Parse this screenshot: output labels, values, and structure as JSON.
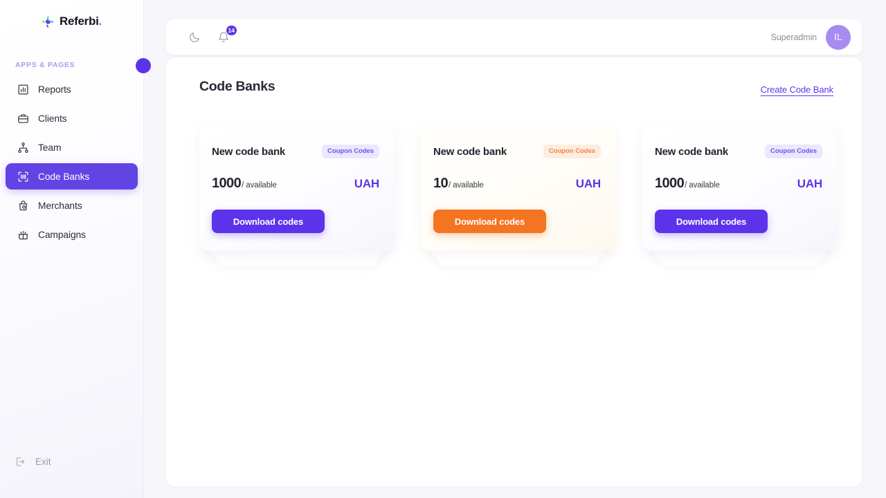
{
  "brand": {
    "name": "Referbi",
    "dot": ".",
    "logo_icon": "pinwheel-logo-icon"
  },
  "sidebar": {
    "section_label": "APPS & PAGES",
    "items": [
      {
        "label": "Reports",
        "icon": "bar-chart-icon",
        "active": false
      },
      {
        "label": "Clients",
        "icon": "briefcase-icon",
        "active": false
      },
      {
        "label": "Team",
        "icon": "org-chart-icon",
        "active": false
      },
      {
        "label": "Code Banks",
        "icon": "barcode-scan-icon",
        "active": true
      },
      {
        "label": "Merchants",
        "icon": "shopping-bag-icon",
        "active": false
      },
      {
        "label": "Campaigns",
        "icon": "gift-burst-icon",
        "active": false
      }
    ],
    "exit": {
      "label": "Exit",
      "icon": "logout-icon"
    },
    "collapse_knob": "collapse-sidebar-knob",
    "accent": "#5c33ea",
    "section_label_color": "#a99cf0"
  },
  "topbar": {
    "theme_toggle_icon": "moon-icon",
    "notifications_icon": "bell-icon",
    "notifications_count": "14",
    "user_name": "Superadmin",
    "avatar_initials": "IL",
    "avatar_color": "#a78bf0"
  },
  "main": {
    "title": "Code Banks",
    "create_link": "Create Code Bank",
    "cards": [
      {
        "title": "New code bank",
        "chip": "Coupon Codes",
        "count": "1000",
        "count_suffix": "/ available",
        "currency": "UAH",
        "button": "Download codes",
        "theme": "purple",
        "button_color": "#5c33ea",
        "chip_bg": "#ebe7fd",
        "chip_fg": "#6f51ef"
      },
      {
        "title": "New code bank",
        "chip": "Coupon Codes",
        "count": "10",
        "count_suffix": "/ available",
        "currency": "UAH",
        "button": "Download codes",
        "theme": "orange",
        "button_color": "#f47421",
        "chip_bg": "#fdece1",
        "chip_fg": "#f2833f"
      },
      {
        "title": "New code bank",
        "chip": "Coupon Codes",
        "count": "1000",
        "count_suffix": "/ available",
        "currency": "UAH",
        "button": "Download codes",
        "theme": "purple",
        "button_color": "#5c33ea",
        "chip_bg": "#ebe7fd",
        "chip_fg": "#6f51ef"
      }
    ]
  }
}
